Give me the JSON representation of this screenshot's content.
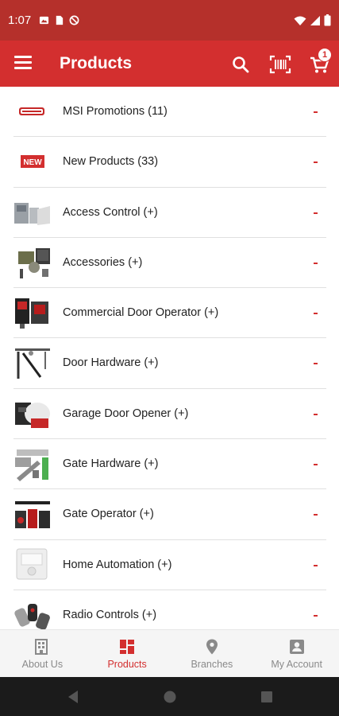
{
  "status": {
    "time": "1:07",
    "left_icons": [
      "image-icon",
      "sim-icon",
      "blocked-icon"
    ],
    "right_icons": [
      "wifi-icon",
      "signal-icon",
      "battery-icon"
    ]
  },
  "appbar": {
    "title": "Products",
    "cart_count": "1",
    "icons": [
      "menu-icon",
      "search-icon",
      "barcode-scan-icon",
      "cart-icon"
    ]
  },
  "items": [
    {
      "label": "MSI Promotions (11)",
      "thumb": "promo-badge-icon"
    },
    {
      "label": "New Products (33)",
      "thumb": "new-badge-icon"
    },
    {
      "label": "Access Control (+)",
      "thumb": "access-control-image"
    },
    {
      "label": "Accessories (+)",
      "thumb": "accessories-image"
    },
    {
      "label": "Commercial Door Operator (+)",
      "thumb": "commercial-door-operator-image"
    },
    {
      "label": "Door Hardware (+)",
      "thumb": "door-hardware-image"
    },
    {
      "label": "Garage Door Opener (+)",
      "thumb": "garage-door-opener-image"
    },
    {
      "label": "Gate Hardware (+)",
      "thumb": "gate-hardware-image"
    },
    {
      "label": "Gate Operator (+)",
      "thumb": "gate-operator-image"
    },
    {
      "label": "Home Automation (+)",
      "thumb": "home-automation-image"
    },
    {
      "label": "Radio Controls (+)",
      "thumb": "radio-controls-image"
    }
  ],
  "bottom_nav": [
    {
      "label": "About Us",
      "icon": "building-icon",
      "active": false
    },
    {
      "label": "Products",
      "icon": "grid-icon",
      "active": true
    },
    {
      "label": "Branches",
      "icon": "location-pin-icon",
      "active": false
    },
    {
      "label": "My Account",
      "icon": "account-icon",
      "active": false
    }
  ],
  "colors": {
    "status_bar": "#b5302b",
    "app_bar": "#d32f2f",
    "accent": "#d32f2f",
    "nav_inactive": "#8a8a8a"
  }
}
